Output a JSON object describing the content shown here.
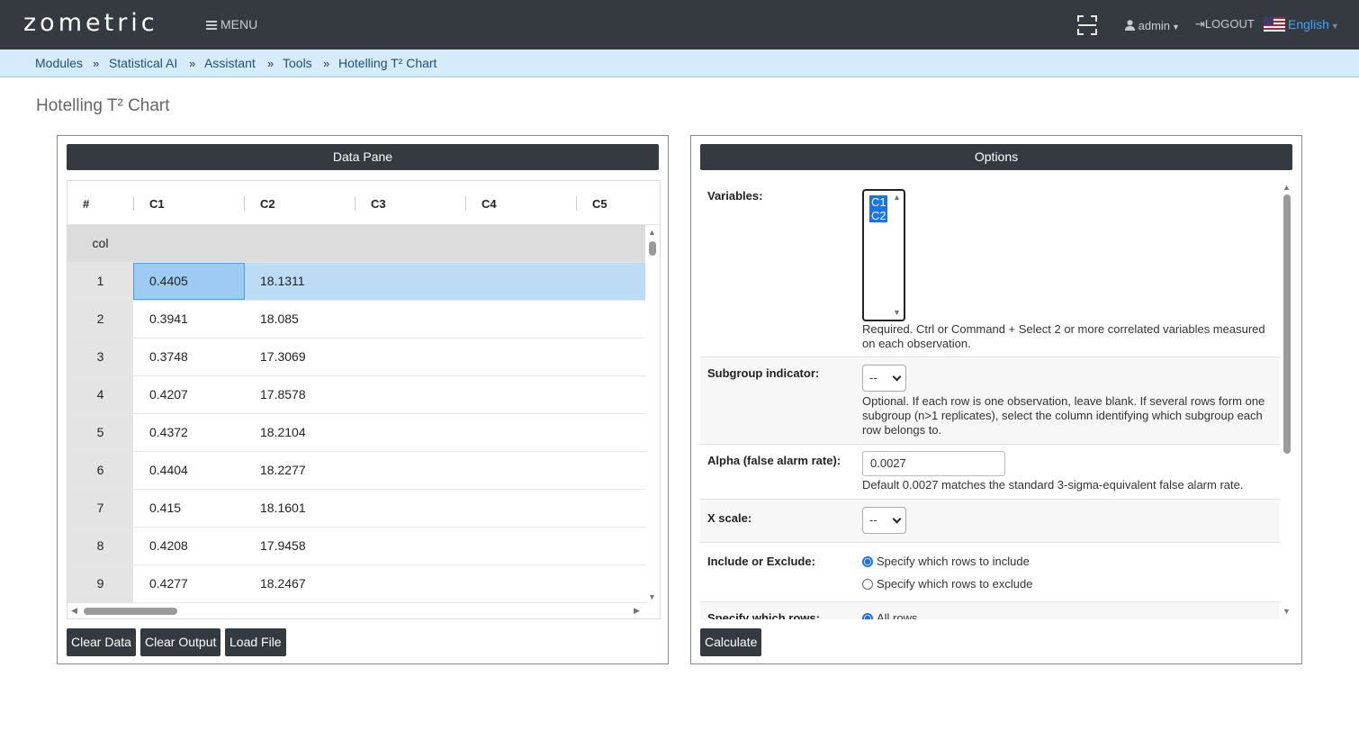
{
  "navbar": {
    "logo": "zometric",
    "menu_label": "MENU",
    "user_label": "admin",
    "logout_label": "LOGOUT",
    "language_label": "English",
    "icons": [
      "menu-icon",
      "scan-icon",
      "user-icon",
      "logout-icon",
      "us-flag-icon"
    ]
  },
  "breadcrumb": {
    "items": [
      "Modules",
      "Statistical AI",
      "Assistant",
      "Tools",
      "Hotelling T² Chart"
    ],
    "separator": "»"
  },
  "page_title": "Hotelling T² Chart",
  "data_pane": {
    "title": "Data Pane",
    "columns": [
      "#",
      "C1",
      "C2",
      "C3",
      "C4",
      "C5"
    ],
    "col_row_label": "col",
    "rows": [
      {
        "n": "1",
        "c1": "0.4405",
        "c2": "18.1311"
      },
      {
        "n": "2",
        "c1": "0.3941",
        "c2": "18.085"
      },
      {
        "n": "3",
        "c1": "0.3748",
        "c2": "17.3069"
      },
      {
        "n": "4",
        "c1": "0.4207",
        "c2": "17.8578"
      },
      {
        "n": "5",
        "c1": "0.4372",
        "c2": "18.2104"
      },
      {
        "n": "6",
        "c1": "0.4404",
        "c2": "18.2277"
      },
      {
        "n": "7",
        "c1": "0.415",
        "c2": "18.1601"
      },
      {
        "n": "8",
        "c1": "0.4208",
        "c2": "17.9458"
      },
      {
        "n": "9",
        "c1": "0.4277",
        "c2": "18.2467"
      }
    ],
    "buttons": {
      "clear_data": "Clear Data",
      "clear_output": "Clear Output",
      "load_file": "Load File"
    }
  },
  "options": {
    "title": "Options",
    "variables": {
      "label": "Variables:",
      "selected": [
        "C1",
        "C2"
      ],
      "help": "Required. Ctrl or Command + Select 2 or more correlated variables measured on each observation."
    },
    "subgroup": {
      "label": "Subgroup indicator:",
      "value": "--",
      "help": "Optional. If each row is one observation, leave blank. If several rows form one subgroup (n>1 replicates), select the column identifying which subgroup each row belongs to."
    },
    "alpha": {
      "label": "Alpha (false alarm rate):",
      "value": "0.0027",
      "help": "Default 0.0027 matches the standard 3-sigma-equivalent false alarm rate."
    },
    "xscale": {
      "label": "X scale:",
      "value": "--"
    },
    "include_exclude": {
      "label": "Include or Exclude:",
      "opt_include": "Specify which rows to include",
      "opt_exclude": "Specify which rows to exclude",
      "selected": "include"
    },
    "specify_rows": {
      "label": "Specify which rows:",
      "opt_all": "All rows"
    },
    "calculate_label": "Calculate"
  }
}
